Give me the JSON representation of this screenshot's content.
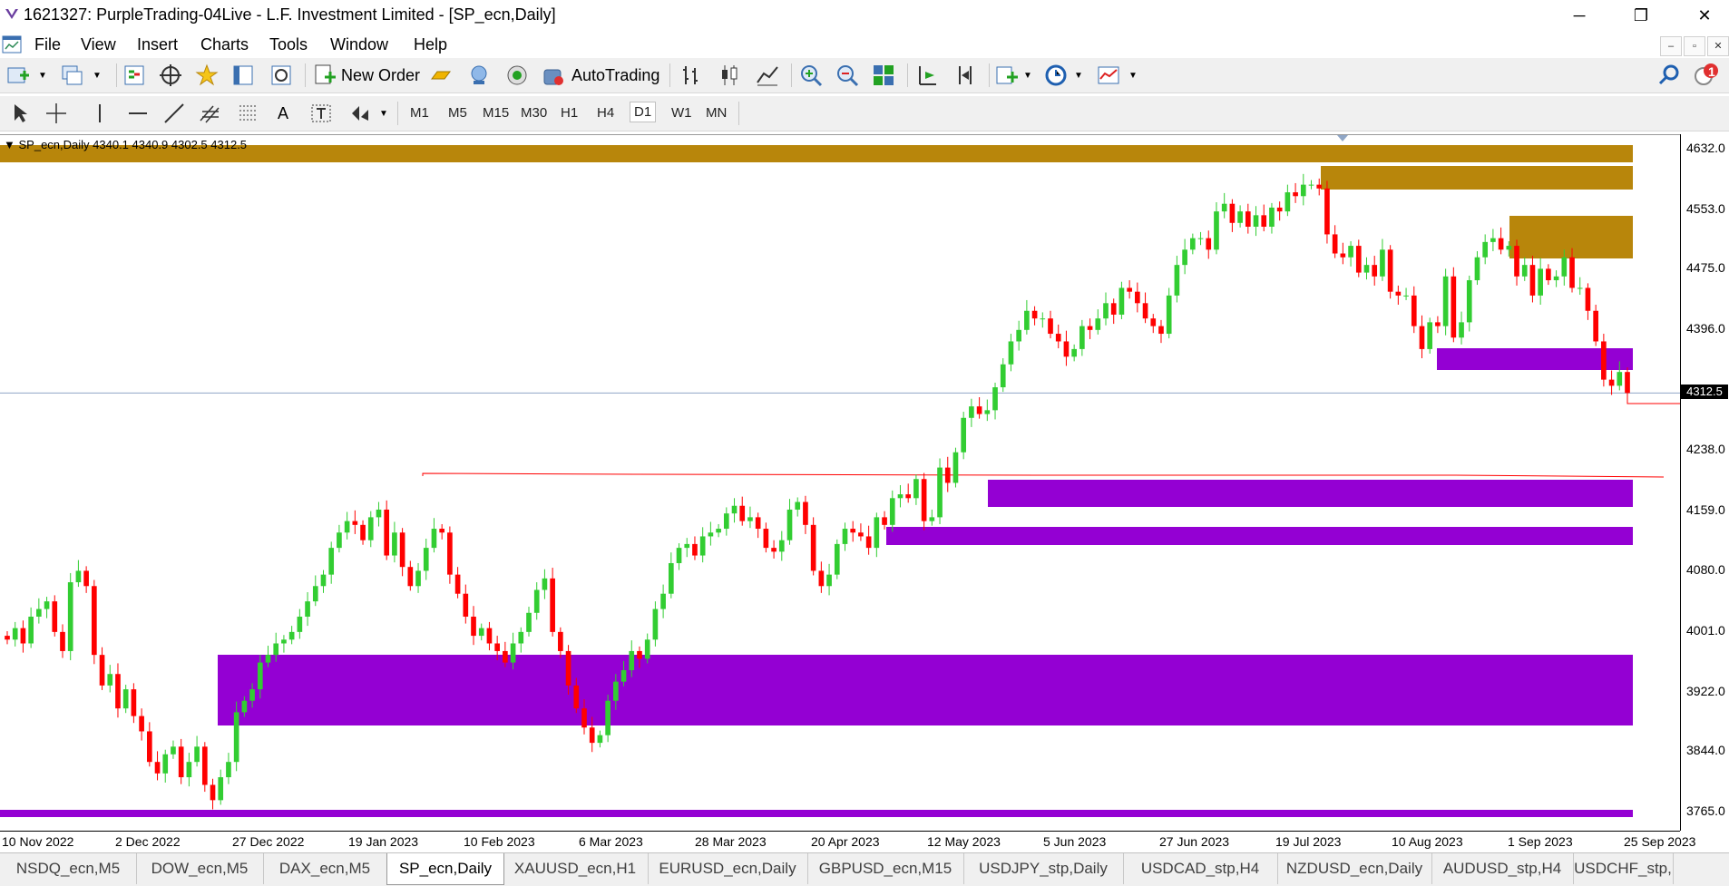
{
  "window": {
    "title": "1621327: PurpleTrading-04Live - L.F. Investment Limited - [SP_ecn,Daily]"
  },
  "menu": [
    "File",
    "View",
    "Insert",
    "Charts",
    "Tools",
    "Window",
    "Help"
  ],
  "toolbar": {
    "new_order": "New Order",
    "autotrading": "AutoTrading",
    "alert_count": "1"
  },
  "timeframes": [
    "M1",
    "M5",
    "M15",
    "M30",
    "H1",
    "H4",
    "D1",
    "W1",
    "MN"
  ],
  "active_timeframe": "D1",
  "chart": {
    "symbol_info": "SP_ecn,Daily  4340.1 4340.9 4302.5 4312.5",
    "current_price": "4312.5",
    "price_labels": [
      "4632.0",
      "4553.0",
      "4475.0",
      "4396.0",
      "4238.0",
      "4159.0",
      "4080.0",
      "4001.0",
      "3922.0",
      "3844.0",
      "3765.0"
    ],
    "time_labels": [
      "10 Nov 2022",
      "2 Dec 2022",
      "27 Dec 2022",
      "19 Jan 2023",
      "10 Feb 2023",
      "6 Mar 2023",
      "28 Mar 2023",
      "20 Apr 2023",
      "12 May 2023",
      "5 Jun 2023",
      "27 Jun 2023",
      "19 Jul 2023",
      "10 Aug 2023",
      "1 Sep 2023",
      "25 Sep 2023"
    ],
    "colors": {
      "bull": "#32cd32",
      "bear": "#ff0000",
      "supply_zone": "#b8860b",
      "demand_zone": "#9400d3",
      "level_line": "#ff0000"
    }
  },
  "tabs": [
    "NSDQ_ecn,M5",
    "DOW_ecn,M5",
    "DAX_ecn,M5",
    "SP_ecn,Daily",
    "XAUUSD_ecn,H1",
    "EURUSD_ecn,Daily",
    "GBPUSD_ecn,M15",
    "USDJPY_stp,Daily",
    "USDCAD_stp,H4",
    "NZDUSD_ecn,Daily",
    "AUDUSD_stp,H4",
    "USDCHF_stp,"
  ],
  "active_tab": "SP_ecn,Daily"
}
